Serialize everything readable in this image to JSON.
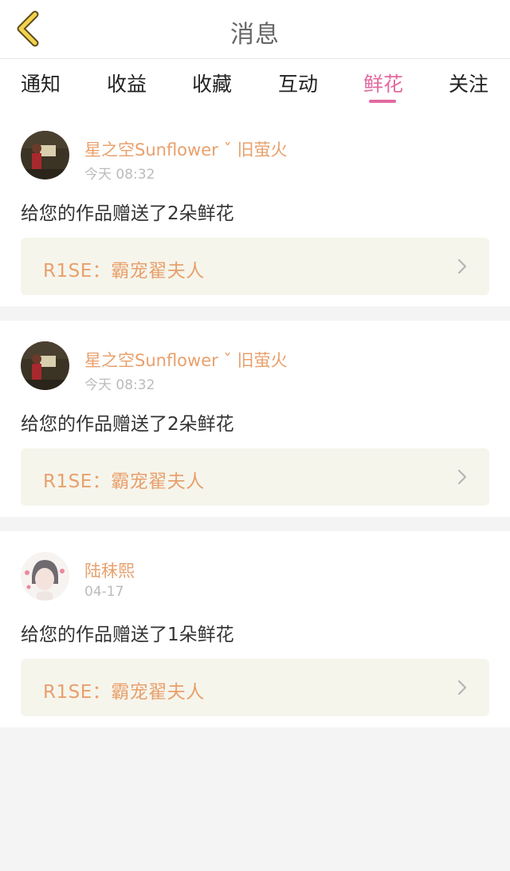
{
  "header": {
    "title": "消息",
    "back_icon": "chevron-left-icon"
  },
  "tabs": [
    {
      "label": "通知"
    },
    {
      "label": "收益"
    },
    {
      "label": "收藏"
    },
    {
      "label": "互动"
    },
    {
      "label": "鲜花",
      "active": true
    },
    {
      "label": "关注"
    }
  ],
  "colors": {
    "accent": "#e26aa1",
    "name": "#e8a06c",
    "link_bg": "#f6f5ec"
  },
  "notifications": [
    {
      "sender": "星之空Sunflower ˇ 旧萤火",
      "time": "今天 08:32",
      "message": "给您的作品赠送了2朵鲜花",
      "work_title": "R1SE：霸宠翟夫人"
    },
    {
      "sender": "星之空Sunflower ˇ 旧萤火",
      "time": "今天 08:32",
      "message": "给您的作品赠送了2朵鲜花",
      "work_title": "R1SE：霸宠翟夫人"
    },
    {
      "sender": "陆秣熙",
      "time": "04-17",
      "message": "给您的作品赠送了1朵鲜花",
      "work_title": "R1SE：霸宠翟夫人"
    }
  ]
}
